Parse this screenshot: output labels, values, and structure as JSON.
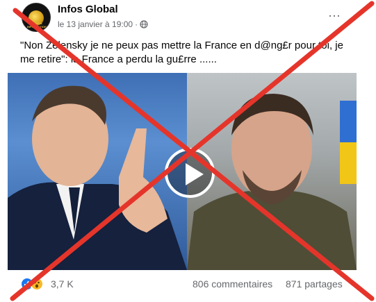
{
  "post": {
    "author": "Infos Global",
    "date": "le 13 janvier à 19:00",
    "separator": "·",
    "more_label": "···",
    "text": "\"Non Zelensky je ne peux pas mettre la France en d@ng£r pour toi, je me retire\": la France a perdu la gu£rre ......"
  },
  "avatar": {
    "logo_text": "GLOBAL INFORMATION"
  },
  "reactions": {
    "count": "3,7 K",
    "comments": "806 commentaires",
    "shares": "871 partages",
    "icons": [
      "like-icon",
      "wow-icon"
    ]
  },
  "colors": {
    "cross": "#e5352b",
    "like": "#1877f2",
    "wow": "#f7b928"
  }
}
